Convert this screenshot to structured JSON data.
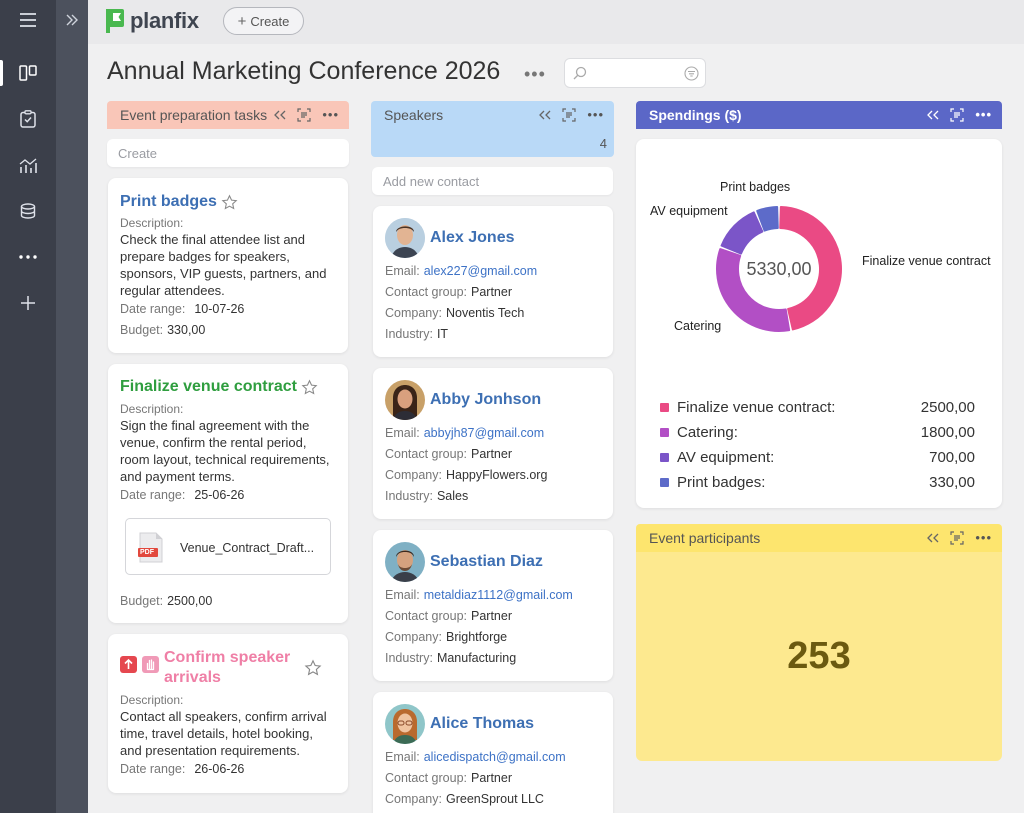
{
  "app": {
    "logo_text": "planfix",
    "create_label": "Create"
  },
  "page": {
    "title": "Annual Marketing Conference 2026",
    "search_placeholder": ""
  },
  "columns": {
    "tasks": {
      "title": "Event preparation tasks",
      "create_placeholder": "Create",
      "color": "#f9c6b8",
      "items": [
        {
          "title": "Print badges",
          "title_color": "#3d6fb3",
          "desc_label": "Description:",
          "description": [
            "Check the final attendee list and",
            "prepare badges for speakers,",
            "sponsors, VIP guests, partners, and",
            "regular attendees."
          ],
          "date_label": "Date range:",
          "date": "10-07-26",
          "budget_label": "Budget:",
          "budget": "330,00"
        },
        {
          "title": "Finalize venue contract",
          "title_color": "#2f9e3f",
          "desc_label": "Description:",
          "description": [
            "Sign the final agreement with the",
            "venue, confirm the rental period,",
            "room layout, technical requirements,",
            "and payment terms."
          ],
          "date_label": "Date range:",
          "date": "25-06-26",
          "attachment": "Venue_Contract_Draft...",
          "attachment_type": "PDF",
          "budget_label": "Budget:",
          "budget": "2500,00"
        },
        {
          "title": "Confirm speaker arrivals",
          "title_line1": "Confirm speaker",
          "title_line2": "arrivals",
          "title_color": "#ef7fa6",
          "desc_label": "Description:",
          "description": [
            "Contact all speakers, confirm arrival",
            "time, travel details, hotel booking,",
            "and presentation requirements."
          ],
          "date_label": "Date range:",
          "date": "26-06-26"
        }
      ]
    },
    "speakers": {
      "title": "Speakers",
      "count": "4",
      "add_placeholder": "Add new contact",
      "color": "#b9d9f7",
      "contacts": [
        {
          "name": "Alex Jones",
          "email": "alex227@gmail.com",
          "group": "Partner",
          "company": "Noventis Tech",
          "industry": "IT"
        },
        {
          "name": "Abby Jonhson",
          "email": "abbyjh87@gmail.com",
          "group": "Partner",
          "company": "HappyFlowers.org",
          "industry": "Sales"
        },
        {
          "name": "Sebastian Diaz",
          "email": "metaldiaz1112@gmail.com",
          "group": "Partner",
          "company": "Brightforge",
          "industry": "Manufacturing"
        },
        {
          "name": "Alice Thomas",
          "email": "alicedispatch@gmail.com",
          "group": "Partner",
          "company": "GreenSprout LLC",
          "industry": ""
        }
      ],
      "labels": {
        "email": "Email:",
        "group": "Contact group:",
        "company": "Company:",
        "industry": "Industry:"
      }
    },
    "spendings": {
      "title": "Spendings ($)",
      "color": "#5b67c7"
    },
    "participants": {
      "title": "Event participants",
      "value": "253",
      "color": "#fde98f"
    }
  },
  "chart_data": {
    "type": "pie",
    "donut": true,
    "total_label": "5330,00",
    "categories": [
      "Finalize venue contract",
      "Catering",
      "AV equipment",
      "Print badges"
    ],
    "values": [
      2500,
      1800,
      700,
      330
    ],
    "value_labels": [
      "2500,00",
      "1800,00",
      "700,00",
      "330,00"
    ],
    "legend_labels": [
      "Finalize venue contract:",
      "Catering:",
      "AV equipment:",
      "Print badges:"
    ],
    "colors": [
      "#ea4a84",
      "#b24fc5",
      "#7b55c8",
      "#5d6bc9"
    ],
    "legend_position": "bottom"
  }
}
